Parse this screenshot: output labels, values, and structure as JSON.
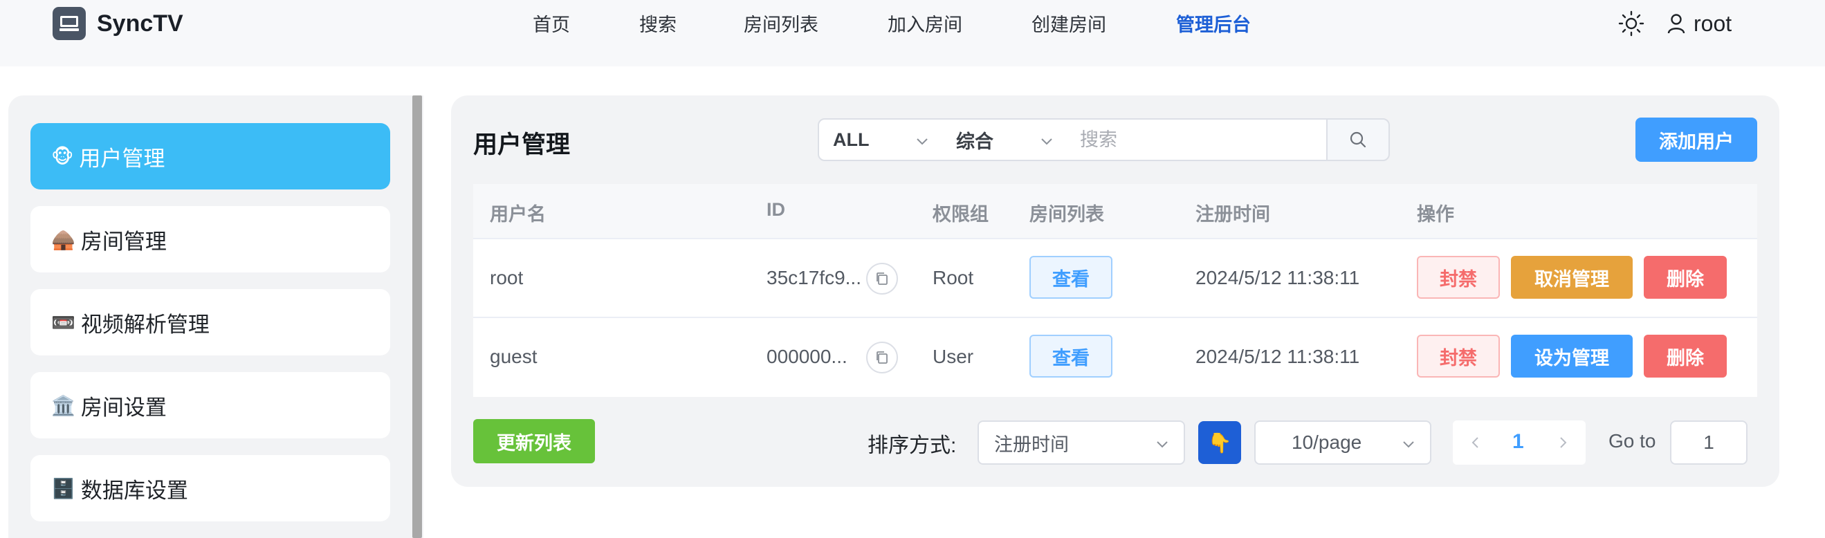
{
  "app": {
    "name": "SyncTV"
  },
  "nav": {
    "items": [
      {
        "label": "首页"
      },
      {
        "label": "搜索"
      },
      {
        "label": "房间列表"
      },
      {
        "label": "加入房间"
      },
      {
        "label": "创建房间"
      },
      {
        "label": "管理后台",
        "active": true
      }
    ]
  },
  "user": {
    "name": "root",
    "theme_icon": "sun-icon",
    "user_icon": "user-icon"
  },
  "sidebar": {
    "items": [
      {
        "emoji": "🐵",
        "label": "用户管理",
        "active": true
      },
      {
        "emoji": "🛖",
        "label": "房间管理"
      },
      {
        "emoji": "📼",
        "label": "视频解析管理"
      },
      {
        "emoji": "🏛️",
        "label": "房间设置"
      },
      {
        "emoji": "🗄️",
        "label": "数据库设置"
      }
    ]
  },
  "main": {
    "title": "用户管理",
    "filter_role": "ALL",
    "filter_field": "综合",
    "search_placeholder": "搜索",
    "add_user_label": "添加用户"
  },
  "table": {
    "columns": [
      "用户名",
      "ID",
      "权限组",
      "房间列表",
      "注册时间",
      "操作"
    ],
    "rows": [
      {
        "username": "root",
        "id": "35c17fc9...",
        "role": "Root",
        "rooms_label": "查看",
        "registered": "2024/5/12 11:38:11",
        "actions": [
          "封禁",
          "取消管理",
          "删除"
        ]
      },
      {
        "username": "guest",
        "id": "000000...",
        "role": "User",
        "rooms_label": "查看",
        "registered": "2024/5/12 11:38:11",
        "actions": [
          "封禁",
          "设为管理",
          "删除"
        ]
      }
    ]
  },
  "footer": {
    "refresh_label": "更新列表",
    "sort_label": "排序方式:",
    "sort_value": "注册时间",
    "order_emoji": "👇",
    "page_size": "10/page",
    "current_page": "1",
    "goto_label": "Go to",
    "goto_value": "1"
  },
  "colors": {
    "accent": "#409eff",
    "active_nav": "#1d5fd6",
    "sidebar_active": "#3cbcf6",
    "success": "#67c23a",
    "warning": "#e6a23c",
    "danger": "#f56c6c"
  }
}
